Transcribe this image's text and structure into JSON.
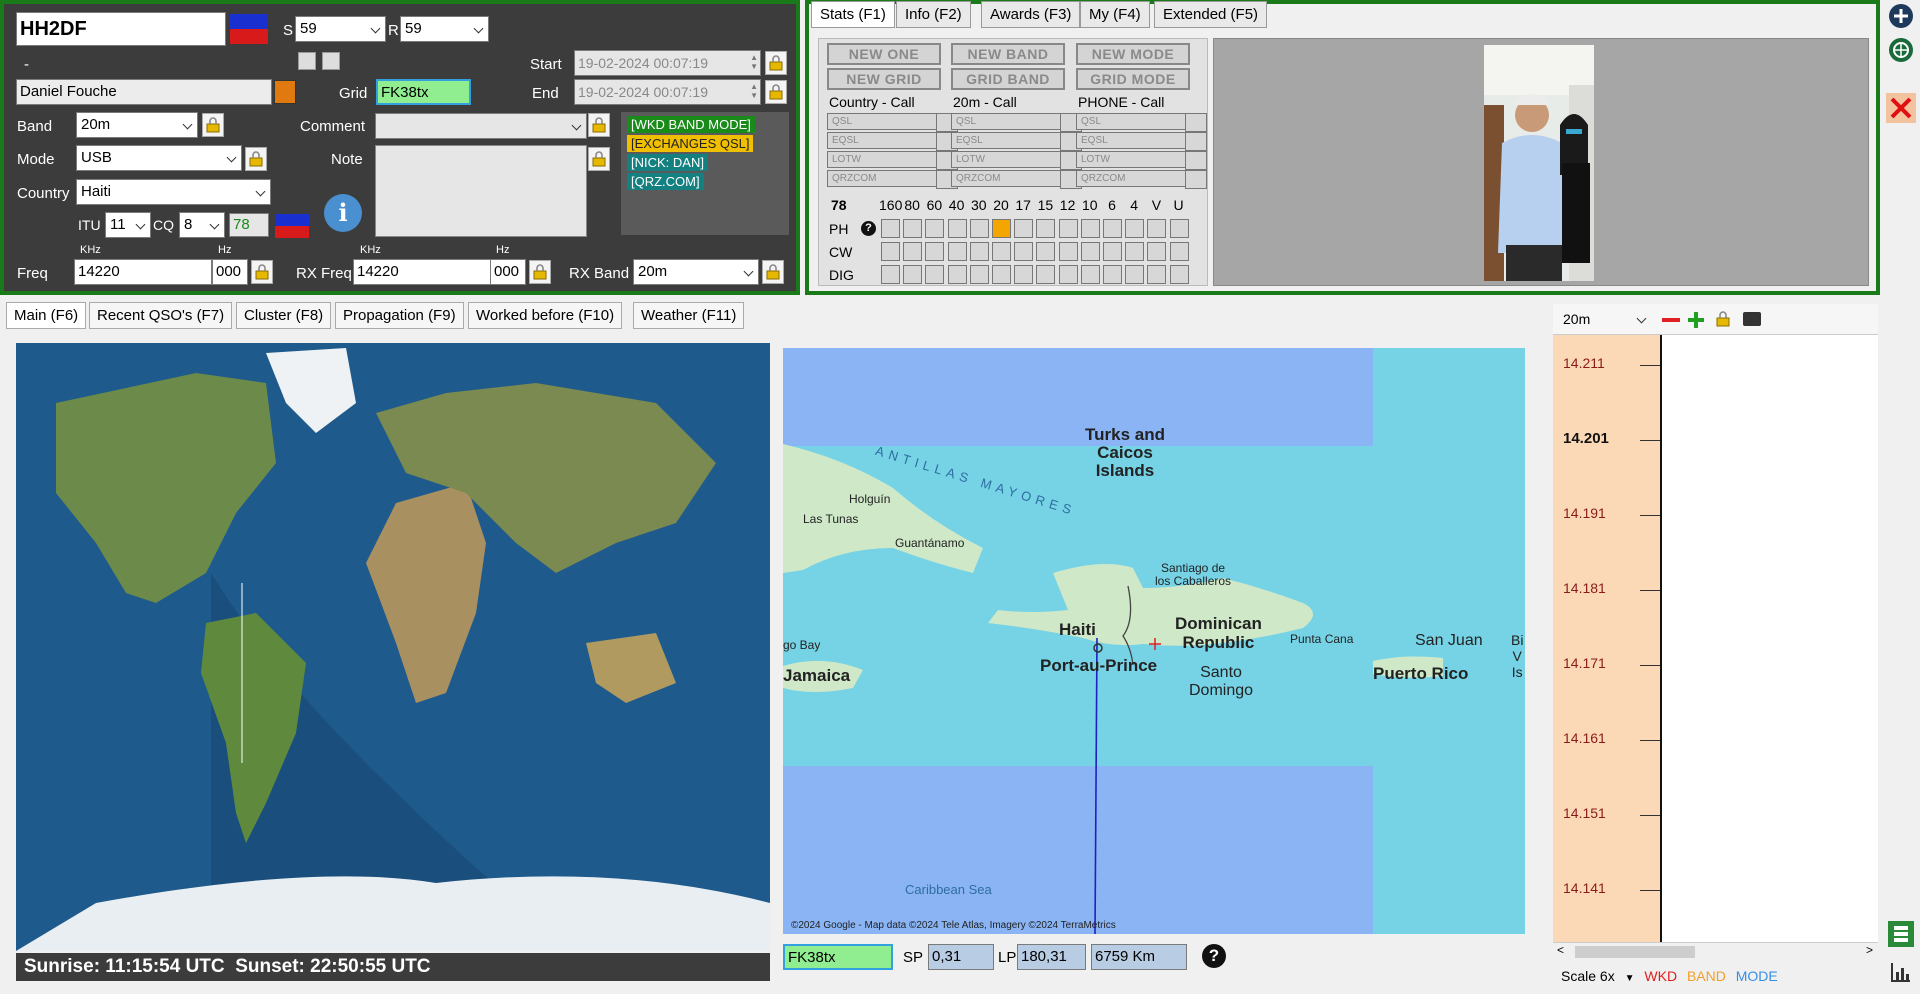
{
  "entry": {
    "callsign": "HH2DF",
    "s_label": "S",
    "s_value": "59",
    "r_label": "R",
    "r_value": "59",
    "dash": "-",
    "name": "Daniel Fouche",
    "grid_label": "Grid",
    "grid_value": "FK38tx",
    "start_label": "Start",
    "start_value": "19-02-2024 00:07:19",
    "end_label": "End",
    "end_value": "19-02-2024 00:07:19",
    "band_label": "Band",
    "band_value": "20m",
    "comment_label": "Comment",
    "comment_value": "",
    "mode_label": "Mode",
    "mode_value": "USB",
    "note_label": "Note",
    "country_label": "Country",
    "country_value": "Haiti",
    "itu_label": "ITU",
    "itu_value": "11",
    "cq_label": "CQ",
    "cq_value": "8",
    "count_value": "78",
    "tags": [
      "[WKD BAND MODE]",
      "[EXCHANGES QSL]",
      "[NICK: DAN]",
      "[QRZ.COM]"
    ],
    "khz_label": "KHz",
    "hz_label": "Hz",
    "freq_label": "Freq",
    "freq_value": "14220",
    "freq_hz": "000",
    "rxfreq_label": "RX Freq",
    "rxfreq_value": "14220",
    "rxfreq_hz": "000",
    "rxband_label": "RX Band",
    "rxband_value": "20m"
  },
  "stats": {
    "tabs": [
      "Stats (F1)",
      "Info (F2)",
      "Awards (F3)",
      "My (F4)",
      "Extended (F5)"
    ],
    "buttons": [
      "NEW ONE",
      "NEW BAND",
      "NEW MODE",
      "NEW GRID",
      "GRID BAND",
      "GRID MODE"
    ],
    "col_heads": [
      "Country - Call",
      "20m - Call",
      "PHONE - Call"
    ],
    "qsl_rows": [
      "QSL",
      "EQSL",
      "LOTW",
      "QRZCOM"
    ],
    "count": "78",
    "bands": [
      "160",
      "80",
      "60",
      "40",
      "30",
      "20",
      "17",
      "15",
      "12",
      "10",
      "6",
      "4",
      "V",
      "U"
    ],
    "modes": [
      "PH",
      "CW",
      "DIG"
    ],
    "worked": {
      "mode": "PH",
      "band": "20"
    }
  },
  "main_tabs": [
    "Main (F6)",
    "Recent QSO's (F7)",
    "Cluster (F8)",
    "Propagation (F9)",
    "Worked before (F10)",
    "Weather (F11)"
  ],
  "sun": {
    "text": "Sunrise: 11:15:54 UTC  Sunset: 22:50:55 UTC"
  },
  "map": {
    "labels": {
      "turks": "Turks and\nCaicos\nIslands",
      "antillas": "ANTILLAS MAYORES",
      "holguin": "Holguín",
      "lastunas": "Las Tunas",
      "guantanamo": "Guantánamo",
      "santiago": "Santiago de\nlos Caballeros",
      "haiti": "Haiti",
      "dominican": "Dominican\nRepublic",
      "puntacana": "Punta Cana",
      "sanjuan": "San Juan",
      "bi": "Bi\nV\nIs",
      "gobay": "go Bay",
      "jamaica": "Jamaica",
      "portauprince": "Port-au-Prince",
      "santodomingo": "Santo\nDomingo",
      "puertorico": "Puerto Rico",
      "caribbean": "Caribbean Sea"
    },
    "attribution": "©2024 Google - Map data ©2024 Tele Atlas, Imagery ©2024 TerraMetrics"
  },
  "bottom": {
    "grid": "FK38tx",
    "sp_label": "SP",
    "sp": "0,31",
    "lp_label": "LP",
    "lp": "180,31",
    "dist": "6759 Km"
  },
  "bandmap": {
    "band": "20m",
    "freqs": [
      "14.211",
      "14.201",
      "14.191",
      "14.181",
      "14.171",
      "14.161",
      "14.151",
      "14.141"
    ],
    "bold_freq": "14.201",
    "scale": "Scale 6x",
    "wkd": "WKD",
    "band_leg": "BAND",
    "mode_leg": "MODE",
    "colors": {
      "wkd": "#e02020",
      "band": "#f0a030",
      "mode": "#3a8ee0",
      "freq": "#8b1a1a",
      "panel": "#fcd9b6"
    }
  }
}
